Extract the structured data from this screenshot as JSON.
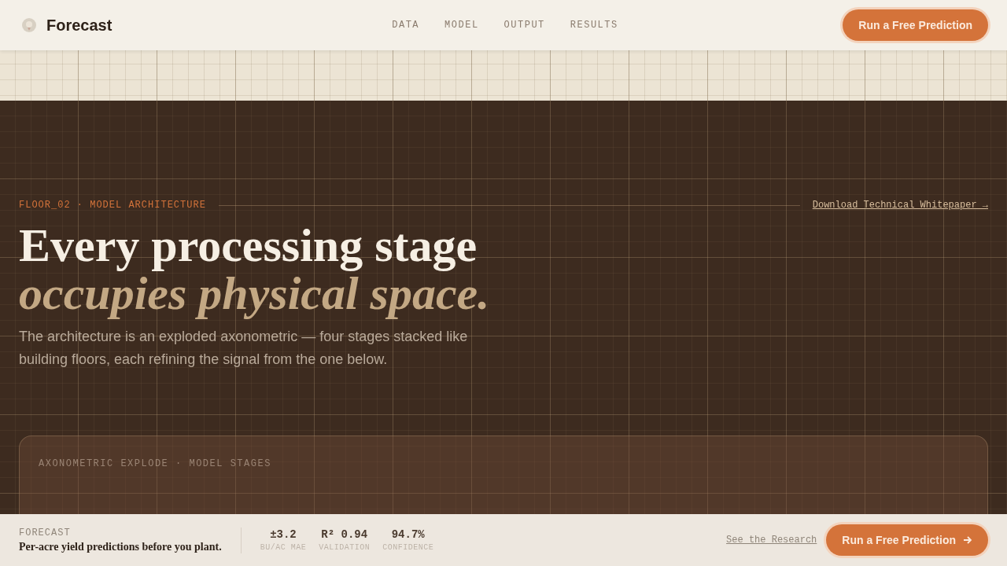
{
  "brand": {
    "name": "Forecast"
  },
  "nav": [
    "DATA",
    "MODEL",
    "OUTPUT",
    "RESULTS"
  ],
  "header_cta": "Run a Free Prediction",
  "hero": {
    "eyebrow": "FLOOR_02 · MODEL ARCHITECTURE",
    "link": "Download Technical Whitepaper →",
    "title_line_1": "Every processing stage",
    "title_line_2": "occupies physical space.",
    "body": "The architecture is an exploded axonometric — four stages stacked like building floors, each refining the signal from the one below."
  },
  "panel": {
    "label": "AXONOMETRIC EXPLODE · MODEL STAGES"
  },
  "footer": {
    "eyebrow": "FORECAST",
    "tagline": "Per-acre yield predictions before you plant.",
    "stats": [
      {
        "value": "±3.2",
        "label": "BU/AC MAE"
      },
      {
        "value": "R² 0.94",
        "label": "VALIDATION"
      },
      {
        "value": "94.7%",
        "label": "CONFIDENCE"
      }
    ],
    "link": "See the Research",
    "cta": "Run a Free Prediction"
  }
}
